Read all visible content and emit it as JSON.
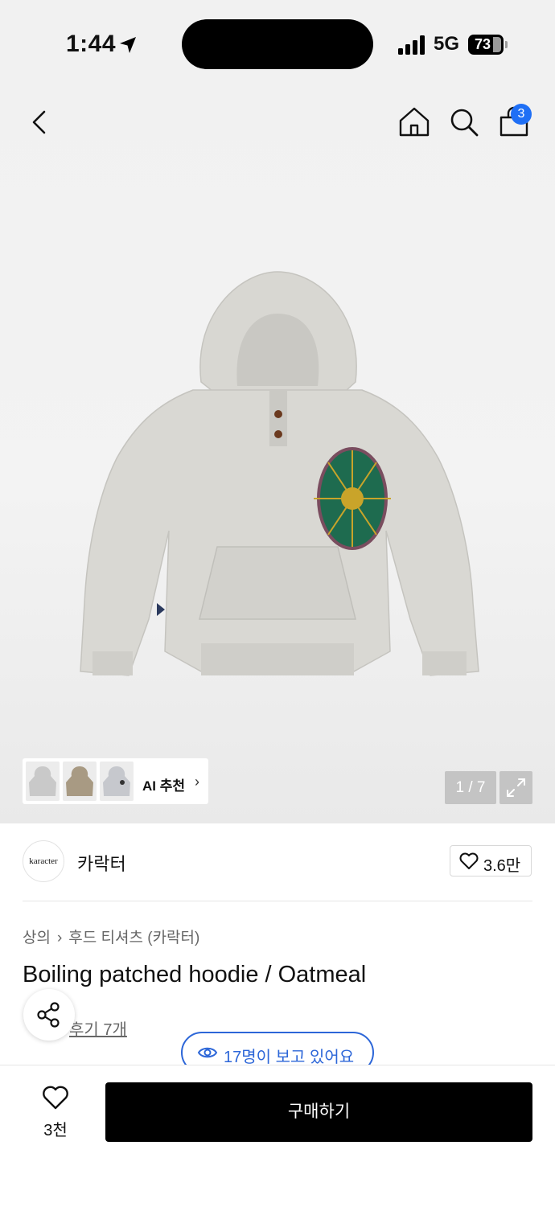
{
  "status_bar": {
    "time": "1:44",
    "network": "5G",
    "battery": "73"
  },
  "header": {
    "cart_count": "3"
  },
  "gallery": {
    "ai_label": "AI 추천",
    "counter": "1 / 7"
  },
  "brand": {
    "logo_text": "karacter",
    "name": "카락터",
    "likes": "3.6만"
  },
  "breadcrumb": [
    "상의",
    "후드 티셔츠 (카락터)"
  ],
  "product": {
    "title": "Boiling patched hoodie / Oatmeal",
    "reviews": "후기 7개"
  },
  "viewers": "17명이 보고 있어요",
  "bottom": {
    "wish_count": "3천",
    "buy_label": "구매하기"
  }
}
